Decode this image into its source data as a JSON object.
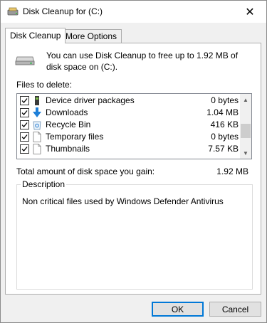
{
  "window": {
    "title": "Disk Cleanup for  (C:)",
    "close_glyph": "✕"
  },
  "tabs": [
    {
      "label": "Disk Cleanup",
      "active": true
    },
    {
      "label": "More Options",
      "active": false
    }
  ],
  "intro_text": "You can use Disk Cleanup to free up to 1.92 MB of disk space on  (C:).",
  "files_label": "Files to delete:",
  "files": [
    {
      "name": "Device driver packages",
      "size": "0 bytes",
      "checked": true,
      "icon": "driver-icon"
    },
    {
      "name": "Downloads",
      "size": "1.04 MB",
      "checked": true,
      "icon": "download-arrow-icon"
    },
    {
      "name": "Recycle Bin",
      "size": "416 KB",
      "checked": true,
      "icon": "recycle-bin-icon"
    },
    {
      "name": "Temporary files",
      "size": "0 bytes",
      "checked": true,
      "icon": "file-icon"
    },
    {
      "name": "Thumbnails",
      "size": "7.57 KB",
      "checked": true,
      "icon": "file-icon"
    }
  ],
  "total_label": "Total amount of disk space you gain:",
  "total_value": "1.92 MB",
  "description": {
    "legend": "Description",
    "text": "Non critical files used by Windows Defender Antivirus"
  },
  "buttons": {
    "ok": "OK",
    "cancel": "Cancel"
  },
  "colors": {
    "accent": "#0078d7",
    "download_arrow": "#1e7fd8"
  }
}
